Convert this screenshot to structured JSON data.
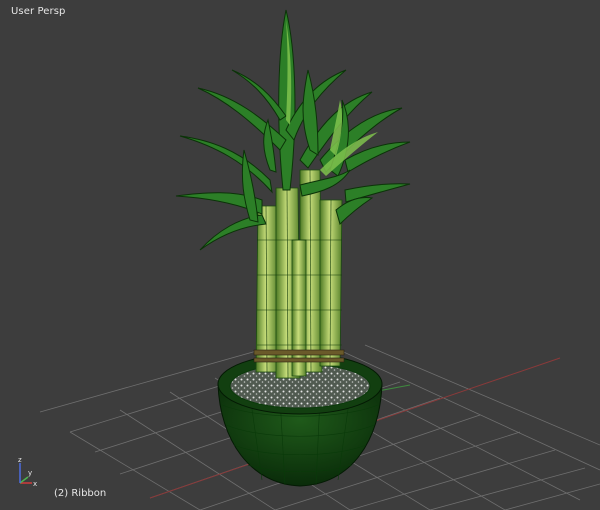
{
  "viewport": {
    "view_label": "User Persp",
    "object_label": "(2) Ribbon"
  },
  "gizmo": {
    "axes": [
      "x",
      "y",
      "z"
    ],
    "colors": {
      "x": "#d13c3c",
      "y": "#4fb34f",
      "z": "#4d6de0"
    }
  },
  "colors": {
    "background": "#3d3d3d",
    "grid": "#6c6c6c",
    "wire": "#0c3d0c",
    "leaf": "#2f8a2a",
    "stalk": "#b9d46b",
    "soil": "#d8d8d8"
  }
}
